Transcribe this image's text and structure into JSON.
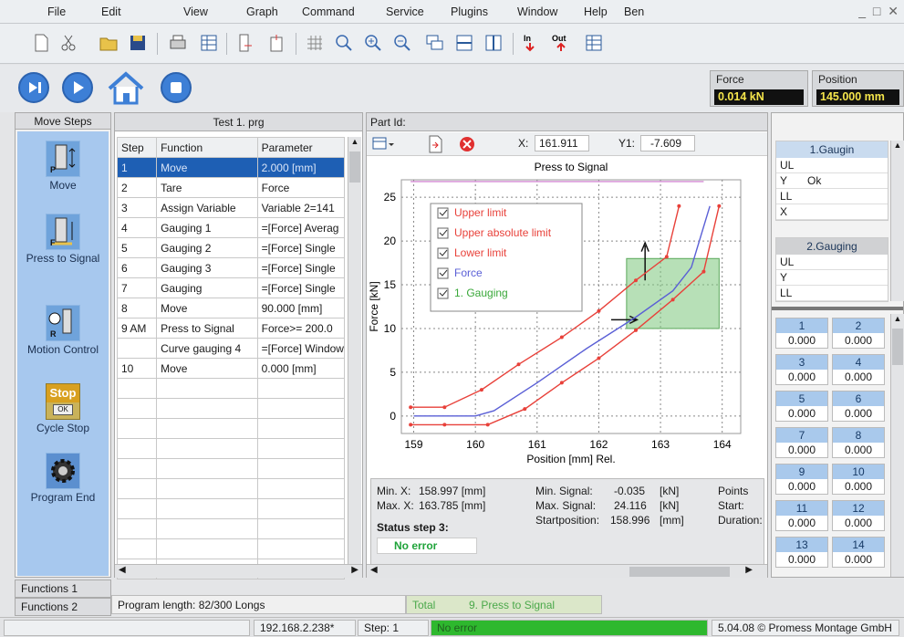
{
  "menu": [
    "File",
    "Edit",
    "View",
    "Graph",
    "Command",
    "Service",
    "Plugins",
    "Window",
    "Help",
    "Ben"
  ],
  "readouts": {
    "force_label": "Force",
    "force_value": "0.014 kN",
    "position_label": "Position",
    "position_value": "145.000 mm"
  },
  "left_panel": {
    "header": "Move Steps",
    "items": [
      {
        "label": "Move",
        "icon": "move-icon",
        "glyph": "P"
      },
      {
        "label": "Press to Signal",
        "icon": "press-to-signal-icon",
        "glyph": "F"
      },
      {
        "label": "Motion Control",
        "icon": "motion-control-icon",
        "glyph": "R"
      },
      {
        "label": "Cycle Stop",
        "icon": "cycle-stop-icon",
        "glyph": "Stop",
        "glyph2": "OK"
      },
      {
        "label": "Program End",
        "icon": "program-end-gear-icon"
      }
    ],
    "tabs": [
      "Functions 1",
      "Functions 2"
    ]
  },
  "program": {
    "title": "Test 1. prg",
    "columns": [
      "Step",
      "Function",
      "Parameter"
    ],
    "rows": [
      {
        "step": "1",
        "function": "Move",
        "parameter": "2.000 [mm]",
        "selected": true
      },
      {
        "step": "2",
        "function": "Tare",
        "parameter": "Force"
      },
      {
        "step": "3",
        "function": "Assign Variable",
        "parameter": "Variable 2=141"
      },
      {
        "step": "4",
        "function": "Gauging 1",
        "parameter": "=[Force] Averag"
      },
      {
        "step": "5",
        "function": "Gauging 2",
        "parameter": "=[Force] Single"
      },
      {
        "step": "6",
        "function": "Gauging 3",
        "parameter": "=[Force] Single"
      },
      {
        "step": "7",
        "function": "Gauging",
        "parameter": "=[Force] Single"
      },
      {
        "step": "8",
        "function": "Move",
        "parameter": "90.000 [mm]"
      },
      {
        "step": "9 AM",
        "function": "Press to Signal",
        "parameter": "Force>= 200.0"
      },
      {
        "step": "",
        "function": "Curve gauging 4",
        "parameter": "=[Force] Window"
      },
      {
        "step": "10",
        "function": "Move",
        "parameter": "0.000 [mm]"
      }
    ],
    "empty_rows": 10,
    "program_length": "Program length: 82/300 Longs"
  },
  "chart_panel": {
    "part_id_label": "Part Id:",
    "x_label": "X:",
    "x_value": "161.911",
    "y_label": "Y1:",
    "y_value": "-7.609"
  },
  "chart_data": {
    "type": "line",
    "title": "Press to Signal",
    "xlabel": "Position [mm] Rel.",
    "ylabel": "Force [kN]",
    "xlim": [
      158.8,
      164.3
    ],
    "ylim": [
      -2,
      27
    ],
    "xticks": [
      159,
      160,
      161,
      162,
      163,
      164
    ],
    "yticks": [
      0,
      5,
      10,
      15,
      20,
      25
    ],
    "grid": true,
    "legend_position": "top-left",
    "legend": [
      {
        "name": "Upper limit",
        "color": "#e8413a",
        "checked": true
      },
      {
        "name": "Upper absolute limit",
        "color": "#e8413a",
        "checked": true
      },
      {
        "name": "Lower limit",
        "color": "#e8413a",
        "checked": true
      },
      {
        "name": "Force",
        "color": "#5a5fd6",
        "checked": true
      },
      {
        "name": "1. Gauging",
        "color": "#3aa83a",
        "checked": true
      }
    ],
    "series": [
      {
        "name": "Upper limit",
        "color": "#e8413a",
        "markers": true,
        "points": [
          [
            158.95,
            1.0
          ],
          [
            159.5,
            1.0
          ],
          [
            160.1,
            3.0
          ],
          [
            160.7,
            5.9
          ],
          [
            161.4,
            9.0
          ],
          [
            162.0,
            12.0
          ],
          [
            162.6,
            15.5
          ],
          [
            163.1,
            18.2
          ],
          [
            163.3,
            24.0
          ]
        ]
      },
      {
        "name": "Upper absolute limit",
        "color": "#d48ad4",
        "markers": false,
        "points": [
          [
            158.95,
            26.8
          ],
          [
            163.7,
            26.8
          ]
        ]
      },
      {
        "name": "Lower limit",
        "color": "#e8413a",
        "markers": true,
        "points": [
          [
            158.95,
            -1.0
          ],
          [
            159.5,
            -1.0
          ],
          [
            160.2,
            -1.0
          ],
          [
            160.8,
            0.8
          ],
          [
            161.4,
            3.8
          ],
          [
            162.0,
            6.6
          ],
          [
            162.6,
            9.8
          ],
          [
            163.2,
            13.3
          ],
          [
            163.7,
            16.5
          ],
          [
            163.95,
            24.0
          ]
        ]
      },
      {
        "name": "Force",
        "color": "#5a5fd6",
        "markers": false,
        "points": [
          [
            159.0,
            0.0
          ],
          [
            160.0,
            0.0
          ],
          [
            160.3,
            0.6
          ],
          [
            161.0,
            3.8
          ],
          [
            161.8,
            7.7
          ],
          [
            162.6,
            11.3
          ],
          [
            163.2,
            14.3
          ],
          [
            163.5,
            17.0
          ],
          [
            163.8,
            24.0
          ]
        ]
      }
    ],
    "gauging_window": {
      "x": [
        162.45,
        163.95
      ],
      "y": [
        10.0,
        18.0
      ],
      "color": "#7cc77c"
    }
  },
  "stats": {
    "min_x_label": "Min. X:",
    "min_x": "158.997 [mm]",
    "max_x_label": "Max. X:",
    "max_x": "163.785 [mm]",
    "min_signal_label": "Min. Signal:",
    "min_signal": "-0.035",
    "min_signal_unit": "[kN]",
    "max_signal_label": "Max. Signal:",
    "max_signal": "24.116",
    "max_signal_unit": "[kN]",
    "startpos_label": "Startposition:",
    "startpos": "158.996",
    "startpos_unit": "[mm]",
    "points_label": "Points",
    "start_label": "Start:",
    "duration_label": "Duration:",
    "status_label": "Status step 3:",
    "status_value": "No error"
  },
  "right_panel": {
    "gauge1": {
      "title": "1.Gaugin",
      "rows": [
        {
          "k": "UL",
          "v": ""
        },
        {
          "k": "Y",
          "v": "Ok"
        },
        {
          "k": "LL",
          "v": ""
        },
        {
          "k": "X",
          "v": ""
        }
      ]
    },
    "gauge2": {
      "title": "2.Gauging",
      "rows": [
        {
          "k": "UL",
          "v": ""
        },
        {
          "k": "Y",
          "v": ""
        },
        {
          "k": "LL",
          "v": ""
        }
      ]
    },
    "cells": [
      {
        "n": "1",
        "v": "0.000"
      },
      {
        "n": "2",
        "v": "0.000"
      },
      {
        "n": "3",
        "v": "0.000"
      },
      {
        "n": "4",
        "v": "0.000"
      },
      {
        "n": "5",
        "v": "0.000"
      },
      {
        "n": "6",
        "v": "0.000"
      },
      {
        "n": "7",
        "v": "0.000"
      },
      {
        "n": "8",
        "v": "0.000"
      },
      {
        "n": "9",
        "v": "0.000"
      },
      {
        "n": "10",
        "v": "0.000"
      },
      {
        "n": "11",
        "v": "0.000"
      },
      {
        "n": "12",
        "v": "0.000"
      },
      {
        "n": "13",
        "v": "0.000"
      },
      {
        "n": "14",
        "v": "0.000"
      }
    ]
  },
  "bottom_tabs": {
    "total": "Total",
    "step": "9. Press to Signal"
  },
  "statusbar": {
    "ip": "192.168.2.238*",
    "step": "Step: 1",
    "state": "No error",
    "version": "5.04.08 © Promess Montage GmbH"
  },
  "colors": {
    "accent": "#1e5fb4",
    "ok_green": "#22b03a",
    "status_green": "#2eb82e"
  }
}
